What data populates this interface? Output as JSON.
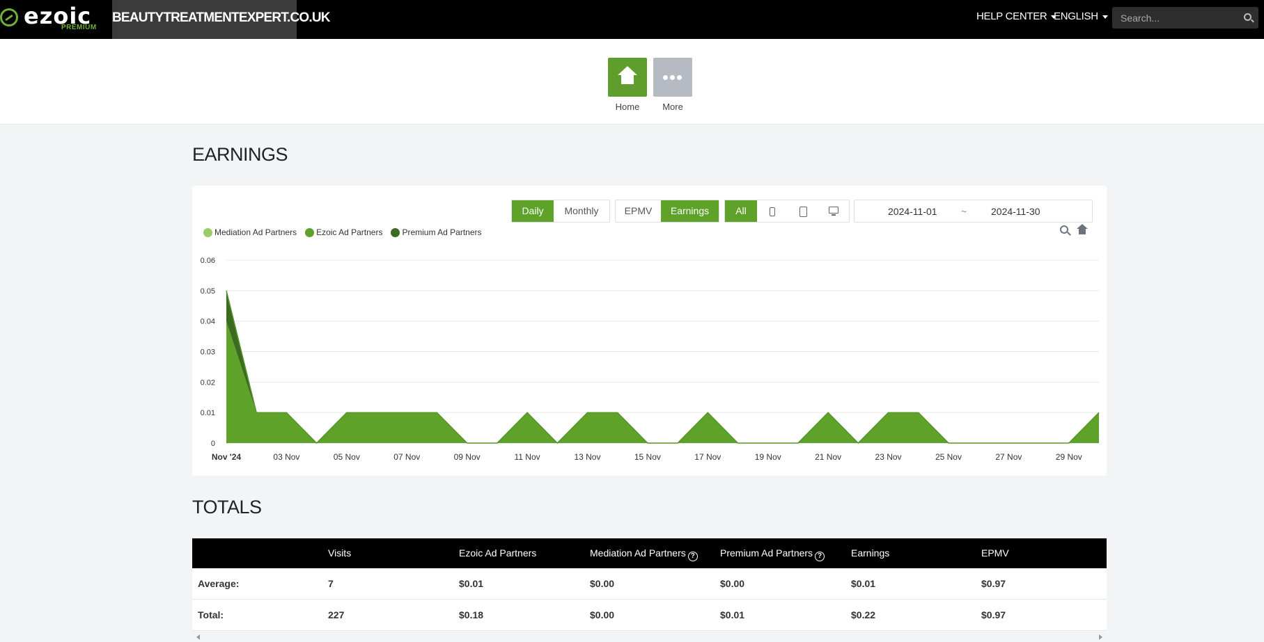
{
  "brand": {
    "logo_text": "ezoic",
    "logo_sub": "PREMIUM",
    "site_name": "BEAUTYTREATMENTEXPERT.CO.UK"
  },
  "topnav": {
    "help_center": "HELP CENTER",
    "language": "ENGLISH",
    "search_placeholder": "Search..."
  },
  "subnav": {
    "home_label": "Home",
    "more_label": "More"
  },
  "earnings": {
    "title": "EARNINGS",
    "period_buttons": [
      "Daily",
      "Monthly"
    ],
    "period_active": "Daily",
    "metric_buttons": [
      "EPMV",
      "Earnings"
    ],
    "metric_active": "Earnings",
    "device_all_label": "All",
    "device_icons": [
      "phone-icon",
      "tablet-icon",
      "desktop-icon"
    ],
    "date_start": "2024-11-01",
    "date_separator": "~",
    "date_end": "2024-11-30"
  },
  "chart_data": {
    "type": "area",
    "stacked": true,
    "title": "",
    "xlabel": "",
    "ylabel": "",
    "x": [
      "01 Nov",
      "02 Nov",
      "03 Nov",
      "04 Nov",
      "05 Nov",
      "06 Nov",
      "07 Nov",
      "08 Nov",
      "09 Nov",
      "10 Nov",
      "11 Nov",
      "12 Nov",
      "13 Nov",
      "14 Nov",
      "15 Nov",
      "16 Nov",
      "17 Nov",
      "18 Nov",
      "19 Nov",
      "20 Nov",
      "21 Nov",
      "22 Nov",
      "23 Nov",
      "24 Nov",
      "25 Nov",
      "26 Nov",
      "27 Nov",
      "28 Nov",
      "29 Nov",
      "30 Nov"
    ],
    "x_tick_labels": [
      "Nov '24",
      "03 Nov",
      "05 Nov",
      "07 Nov",
      "09 Nov",
      "11 Nov",
      "13 Nov",
      "15 Nov",
      "17 Nov",
      "19 Nov",
      "21 Nov",
      "23 Nov",
      "25 Nov",
      "27 Nov",
      "29 Nov"
    ],
    "y_ticks": [
      "0",
      "0.01",
      "0.02",
      "0.03",
      "0.04",
      "0.05",
      "0.06"
    ],
    "ylim": [
      0,
      0.06
    ],
    "grid": true,
    "legend_position": "top-left",
    "series": [
      {
        "name": "Mediation Ad Partners",
        "color": "#9ccc65",
        "values": [
          0,
          0,
          0,
          0,
          0,
          0,
          0,
          0,
          0,
          0,
          0,
          0,
          0,
          0,
          0,
          0,
          0,
          0,
          0,
          0,
          0,
          0,
          0,
          0,
          0,
          0,
          0,
          0,
          0,
          0
        ]
      },
      {
        "name": "Ezoic Ad Partners",
        "color": "#5ea22a",
        "values": [
          0.04,
          0.01,
          0.01,
          0,
          0.01,
          0.01,
          0.01,
          0.01,
          0,
          0,
          0.01,
          0,
          0.01,
          0.01,
          0,
          0,
          0.01,
          0,
          0,
          0,
          0.01,
          0,
          0.01,
          0.01,
          0,
          0,
          0,
          0,
          0,
          0.01
        ]
      },
      {
        "name": "Premium Ad Partners",
        "color": "#3b6b1e",
        "values": [
          0.01,
          0,
          0,
          0,
          0,
          0,
          0,
          0,
          0,
          0,
          0,
          0,
          0,
          0,
          0,
          0,
          0,
          0,
          0,
          0,
          0,
          0,
          0,
          0,
          0,
          0,
          0,
          0,
          0,
          0
        ]
      }
    ]
  },
  "totals": {
    "title": "TOTALS",
    "columns": [
      "",
      "Visits",
      "Ezoic Ad Partners",
      "Mediation Ad Partners",
      "Premium Ad Partners",
      "Earnings",
      "EPMV"
    ],
    "help_columns": [
      3,
      4
    ],
    "rows": [
      [
        "Average:",
        "7",
        "$0.01",
        "$0.00",
        "$0.00",
        "$0.01",
        "$0.97"
      ],
      [
        "Total:",
        "227",
        "$0.18",
        "$0.00",
        "$0.01",
        "$0.22",
        "$0.97"
      ]
    ]
  }
}
